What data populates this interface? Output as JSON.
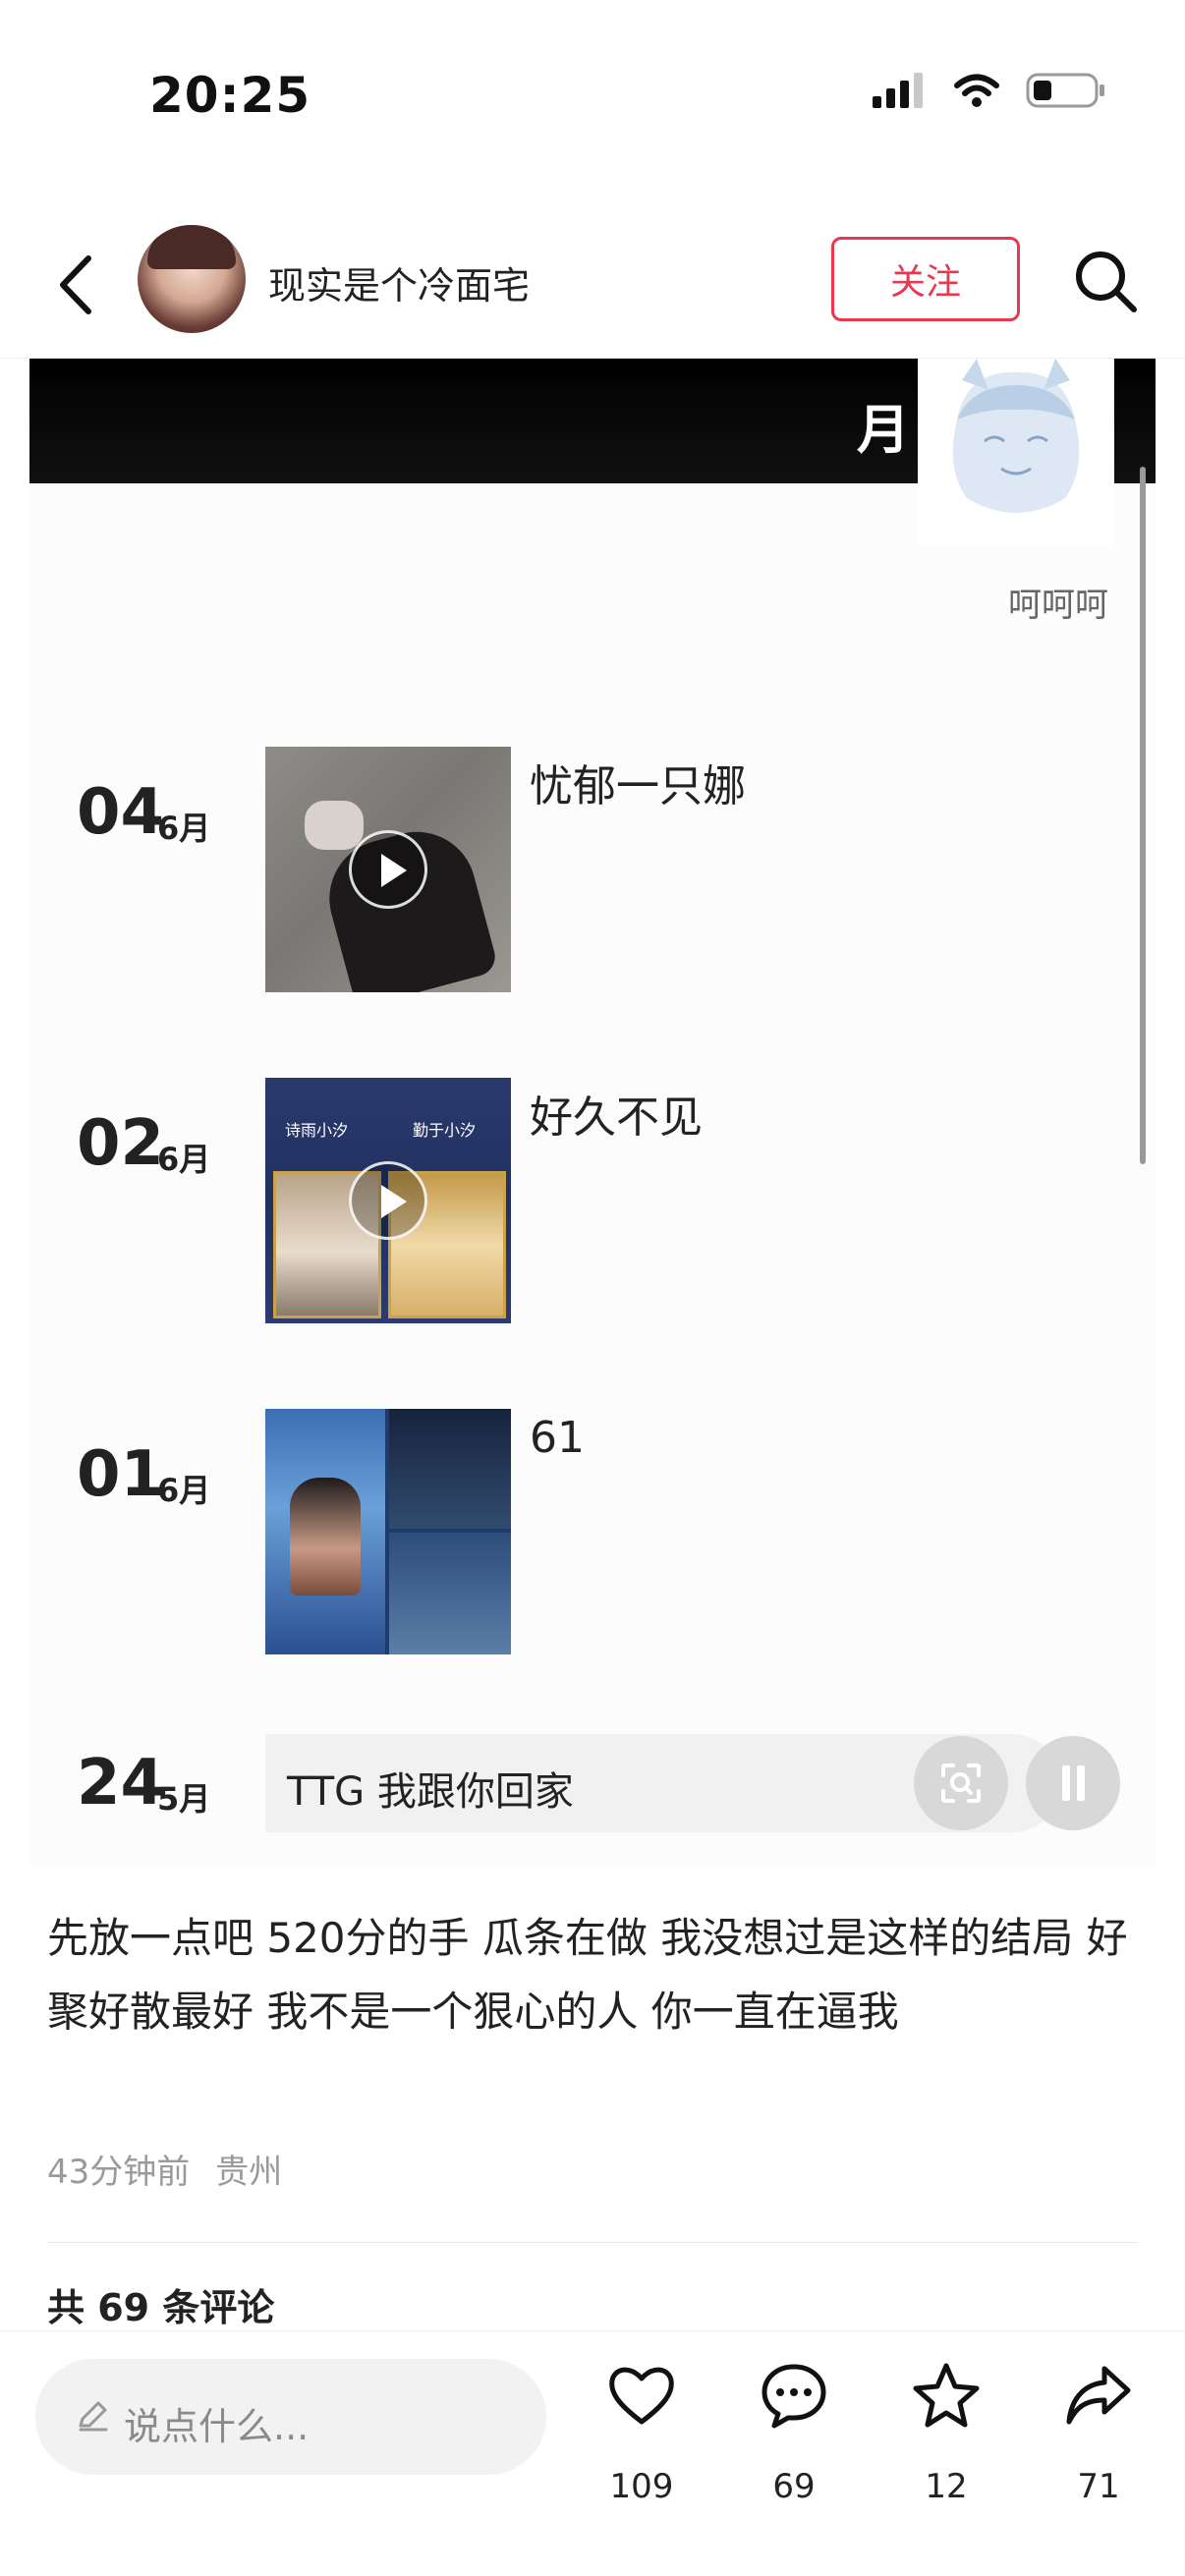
{
  "status_bar": {
    "time": "20:25"
  },
  "header": {
    "username": "现实是个冷面宅",
    "follow_label": "关注"
  },
  "media": {
    "banner_text": "月",
    "sticker_caption": "呵呵呵",
    "posts": [
      {
        "day": "04",
        "month": "6月",
        "title": "忧郁一只娜",
        "has_video": true
      },
      {
        "day": "02",
        "month": "6月",
        "title": "好久不见",
        "has_video": true
      },
      {
        "day": "01",
        "month": "6月",
        "title": "61",
        "has_video": false
      },
      {
        "day": "24",
        "month": "5月",
        "title": ""
      }
    ],
    "thumb2_text_left": "诗雨小汐",
    "thumb2_text_right": "勤于小汐",
    "audio_text": "TTG 我跟你回家"
  },
  "post": {
    "caption": "先放一点吧 520分的手   瓜条在做 我没想过是这样的结局 好聚好散最好 我不是一个狠心的人 你一直在逼我",
    "time_ago": "43分钟前",
    "location": "贵州",
    "comments_header": "共 69 条评论"
  },
  "bottom_bar": {
    "input_placeholder": "说点什么...",
    "likes": "109",
    "comments": "69",
    "favorites": "12",
    "shares": "71"
  }
}
